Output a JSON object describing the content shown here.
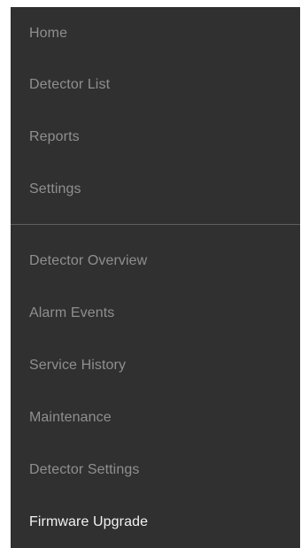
{
  "navigation": {
    "primary_items": [
      {
        "label": "Home",
        "active": false
      },
      {
        "label": "Detector List",
        "active": false
      },
      {
        "label": "Reports",
        "active": false
      },
      {
        "label": "Settings",
        "active": false
      }
    ],
    "detector_items": [
      {
        "label": "Detector Overview",
        "active": false
      },
      {
        "label": "Alarm Events",
        "active": false
      },
      {
        "label": "Service History",
        "active": false
      },
      {
        "label": "Maintenance",
        "active": false
      },
      {
        "label": "Detector Settings",
        "active": false
      },
      {
        "label": "Firmware Upgrade",
        "active": true
      }
    ]
  },
  "colors": {
    "panel_background": "#303030",
    "item_text": "#8f8f8f",
    "active_item_text": "#f2f2f2",
    "divider": "#5e5e5e"
  }
}
